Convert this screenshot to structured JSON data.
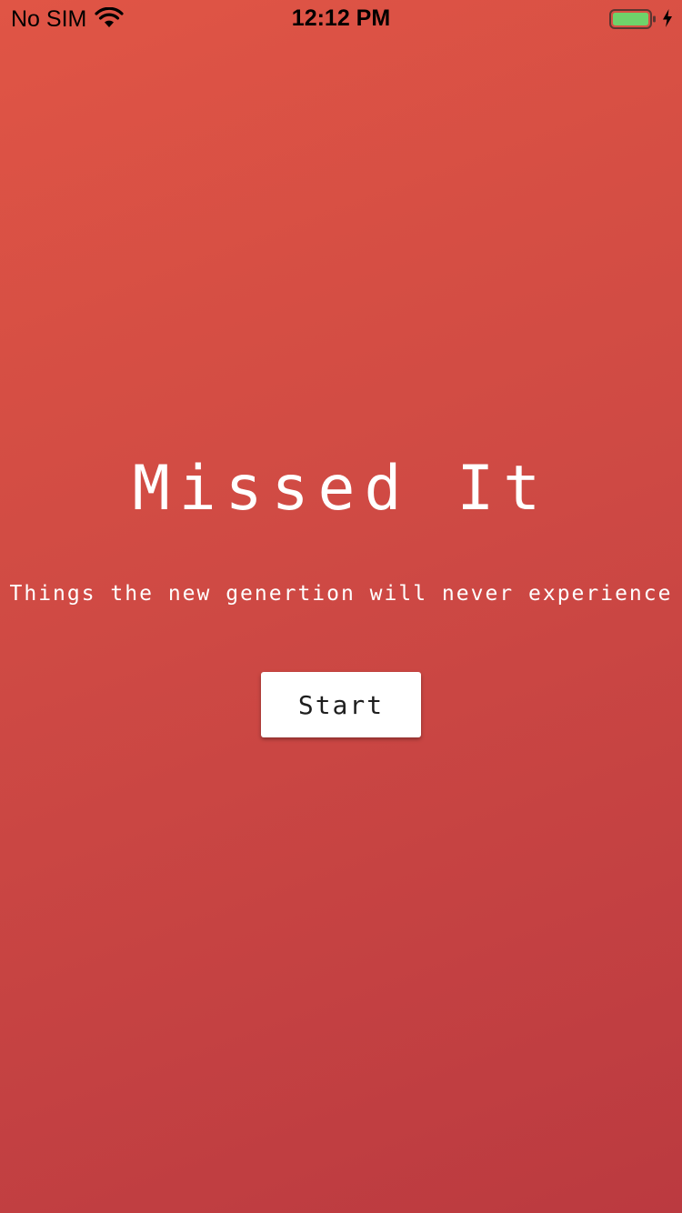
{
  "status_bar": {
    "carrier": "No SIM",
    "time": "12:12 PM",
    "icons": [
      "wifi-icon",
      "battery-icon",
      "charging-bolt-icon"
    ],
    "battery_color": "#6fd26a"
  },
  "main": {
    "title": "Missed It",
    "tagline": "Things the new genertion will never experience",
    "start_label": "Start"
  },
  "colors": {
    "background_top": "#e05545",
    "background_bottom": "#bb3a40",
    "text": "#ffffff",
    "button_bg": "#ffffff",
    "button_text": "#1e1e1e"
  }
}
